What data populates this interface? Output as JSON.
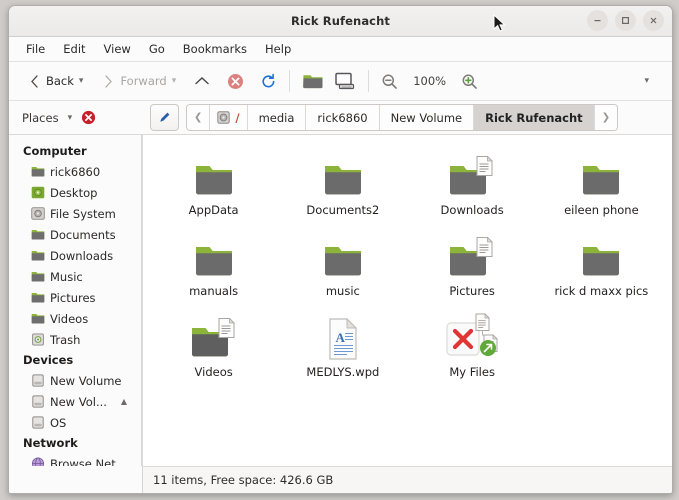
{
  "window": {
    "title": "Rick Rufenacht",
    "controls": {
      "minimize": "minimize-icon",
      "maximize": "maximize-icon",
      "close": "close-icon"
    }
  },
  "menubar": {
    "items": [
      {
        "label": "File"
      },
      {
        "label": "Edit"
      },
      {
        "label": "View"
      },
      {
        "label": "Go"
      },
      {
        "label": "Bookmarks"
      },
      {
        "label": "Help"
      }
    ]
  },
  "toolbar": {
    "back_label": "Back",
    "forward_label": "Forward",
    "up_icon": "chevron-up-icon",
    "stop_icon": "stop-icon",
    "reload_icon": "reload-icon",
    "open_folder_icon": "folder-icon",
    "computer_icon": "computer-icon",
    "zoom_out_icon": "zoom-out-icon",
    "zoom_level": "100%",
    "zoom_in_icon": "zoom-in-icon",
    "overflow_icon": "chevron-down-icon"
  },
  "places": {
    "label": "Places",
    "dropdown_icon": "chevron-down-icon",
    "close_icon": "close-circle-icon"
  },
  "pathbar": {
    "edit_icon": "pencil-icon",
    "prev_icon": "chevron-left-icon",
    "next_icon": "chevron-right-icon",
    "root_label": "/",
    "crumbs": [
      {
        "label": "media",
        "active": false
      },
      {
        "label": "rick6860",
        "active": false
      },
      {
        "label": "New Volume",
        "active": false
      },
      {
        "label": "Rick Rufenacht",
        "active": true
      }
    ]
  },
  "sidebar": {
    "sections": [
      {
        "title": "Computer",
        "items": [
          {
            "label": "rick6860",
            "icon": "folder-icon",
            "eject": false
          },
          {
            "label": "Desktop",
            "icon": "desktop-icon",
            "eject": false
          },
          {
            "label": "File System",
            "icon": "filesystem-icon",
            "eject": false
          },
          {
            "label": "Documents",
            "icon": "folder-icon",
            "eject": false
          },
          {
            "label": "Downloads",
            "icon": "folder-icon",
            "eject": false
          },
          {
            "label": "Music",
            "icon": "folder-icon",
            "eject": false
          },
          {
            "label": "Pictures",
            "icon": "folder-icon",
            "eject": false
          },
          {
            "label": "Videos",
            "icon": "folder-icon",
            "eject": false
          },
          {
            "label": "Trash",
            "icon": "trash-icon",
            "eject": false
          }
        ]
      },
      {
        "title": "Devices",
        "items": [
          {
            "label": "New Volume",
            "icon": "drive-icon",
            "eject": false
          },
          {
            "label": "New Vol...",
            "icon": "drive-icon",
            "eject": true
          },
          {
            "label": "OS",
            "icon": "drive-icon",
            "eject": false
          }
        ]
      },
      {
        "title": "Network",
        "items": [
          {
            "label": "Browse Net...",
            "icon": "network-icon",
            "eject": false
          }
        ]
      }
    ]
  },
  "files": [
    {
      "name": "AppData",
      "icon": "folder-icon",
      "emblem": "none"
    },
    {
      "name": "Documents2",
      "icon": "folder-icon",
      "emblem": "none"
    },
    {
      "name": "Downloads",
      "icon": "folder-icon",
      "emblem": "document"
    },
    {
      "name": "eileen phone",
      "icon": "folder-icon",
      "emblem": "none"
    },
    {
      "name": "manuals",
      "icon": "folder-icon",
      "emblem": "none"
    },
    {
      "name": "music",
      "icon": "folder-icon",
      "emblem": "none"
    },
    {
      "name": "Pictures",
      "icon": "folder-icon",
      "emblem": "document"
    },
    {
      "name": "rick d maxx pics",
      "icon": "folder-icon",
      "emblem": "none"
    },
    {
      "name": "Videos",
      "icon": "folder-icon",
      "emblem": "document"
    },
    {
      "name": "MEDLYS.wpd",
      "icon": "document-icon",
      "emblem": "none"
    },
    {
      "name": "My Files",
      "icon": "broken-link-icon",
      "emblem": "symlink"
    }
  ],
  "statusbar": {
    "text": "11 items, Free space: 426.6 GB"
  },
  "colors": {
    "folder_green": "#8cb33a",
    "folder_gray": "#6b6b6b",
    "accent_blue": "#2a6ec9",
    "close_red": "#cc2b2b",
    "stop_red": "#d96a6a",
    "symlink_green": "#5fa83b",
    "active_crumb_bg": "#d5d2cf",
    "window_bg": "#fbfbfb",
    "content_bg": "#ffffff"
  }
}
